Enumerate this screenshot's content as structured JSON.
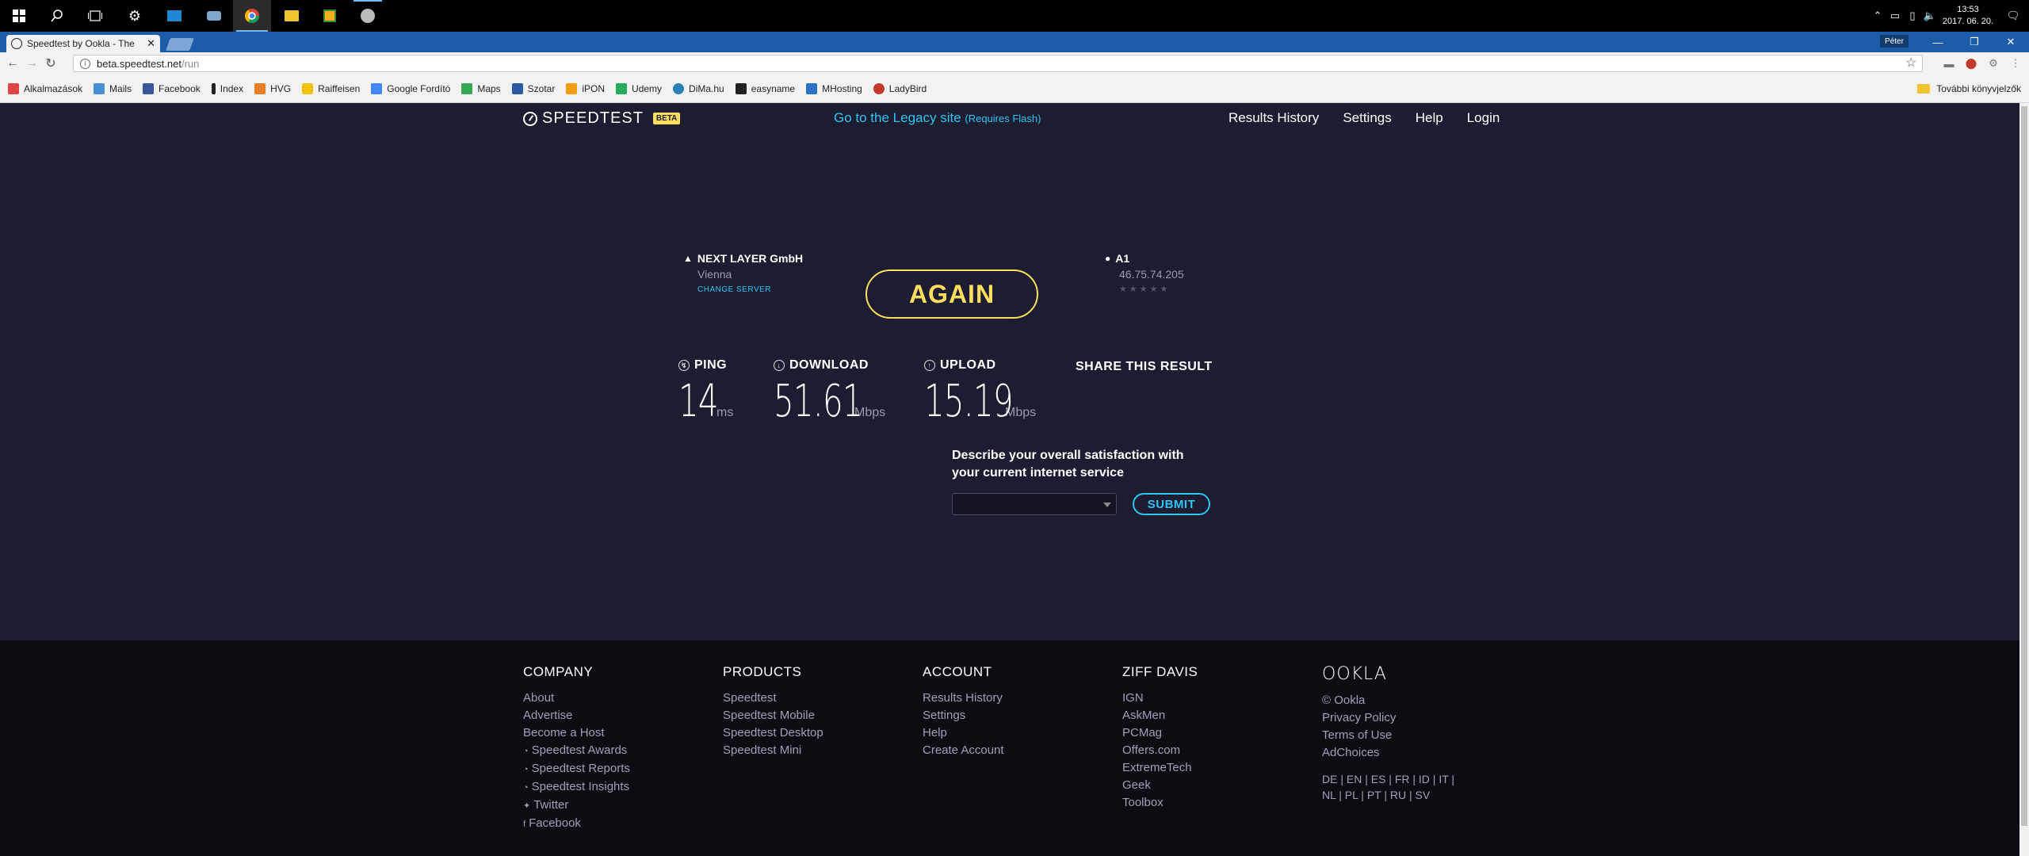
{
  "taskbar": {
    "clock_time": "13:53",
    "clock_date": "2017. 06. 20."
  },
  "browser": {
    "tab_title": "Speedtest by Ookla - The",
    "user_badge": "Péter",
    "url_host": "beta.speedtest.net",
    "url_path": "/run"
  },
  "bookmarks": [
    {
      "label": "Alkalmazások",
      "color": "#d44"
    },
    {
      "label": "Mails",
      "color": "#4a8fd6"
    },
    {
      "label": "Facebook",
      "color": "#3b5998"
    },
    {
      "label": "Index",
      "color": "#222"
    },
    {
      "label": "HVG",
      "color": "#e67e22"
    },
    {
      "label": "Raiffeisen",
      "color": "#f1c40f"
    },
    {
      "label": "Google Fordító",
      "color": "#4285f4"
    },
    {
      "label": "Maps",
      "color": "#34a853"
    },
    {
      "label": "Szotar",
      "color": "#2c5aa0"
    },
    {
      "label": "iPON",
      "color": "#f39c12"
    },
    {
      "label": "Udemy",
      "color": "#27ae60"
    },
    {
      "label": "DiMa.hu",
      "color": "#2980b9"
    },
    {
      "label": "easyname",
      "color": "#222"
    },
    {
      "label": "MHosting",
      "color": "#2c74c9"
    },
    {
      "label": "LadyBird",
      "color": "#c0392b"
    }
  ],
  "bookmarks_other": "További könyvjelzők",
  "header": {
    "logo_text": "SPEEDTEST",
    "beta": "BETA",
    "legacy_link": "Go to the Legacy site",
    "legacy_req": "(Requires Flash)",
    "nav": [
      "Results History",
      "Settings",
      "Help",
      "Login"
    ]
  },
  "server": {
    "name": "NEXT LAYER GmbH",
    "city": "Vienna",
    "change": "CHANGE SERVER"
  },
  "again_label": "AGAIN",
  "client": {
    "name": "A1",
    "ip": "46.75.74.205",
    "stars": "★★★★★"
  },
  "metrics": {
    "ping": {
      "label": "PING",
      "value": "14",
      "unit": "ms"
    },
    "download": {
      "label": "DOWNLOAD",
      "value": "51.61",
      "unit": "Mbps"
    },
    "upload": {
      "label": "UPLOAD",
      "value": "15.19",
      "unit": "Mbps"
    }
  },
  "share_label": "SHARE THIS RESULT",
  "survey": {
    "question": "Describe your overall satisfaction with your current internet service",
    "submit": "SUBMIT"
  },
  "footer": {
    "company": {
      "head": "COMPANY",
      "links": [
        "About",
        "Advertise",
        "Become a Host",
        "Speedtest Awards",
        "Speedtest Reports",
        "Speedtest Insights",
        "Twitter",
        "Facebook"
      ]
    },
    "products": {
      "head": "PRODUCTS",
      "links": [
        "Speedtest",
        "Speedtest Mobile",
        "Speedtest Desktop",
        "Speedtest Mini"
      ]
    },
    "account": {
      "head": "ACCOUNT",
      "links": [
        "Results History",
        "Settings",
        "Help",
        "Create Account"
      ]
    },
    "ziff": {
      "head": "ZIFF DAVIS",
      "links": [
        "IGN",
        "AskMen",
        "PCMag",
        "Offers.com",
        "ExtremeTech",
        "Geek",
        "Toolbox"
      ]
    },
    "ookla": {
      "logo": "OOKLA",
      "links": [
        "© Ookla",
        "Privacy Policy",
        "Terms of Use",
        "AdChoices"
      ]
    },
    "langs_row1": "DE | EN | ES | FR | ID | IT |",
    "langs_row2": "NL | PL | PT | RU | SV"
  }
}
